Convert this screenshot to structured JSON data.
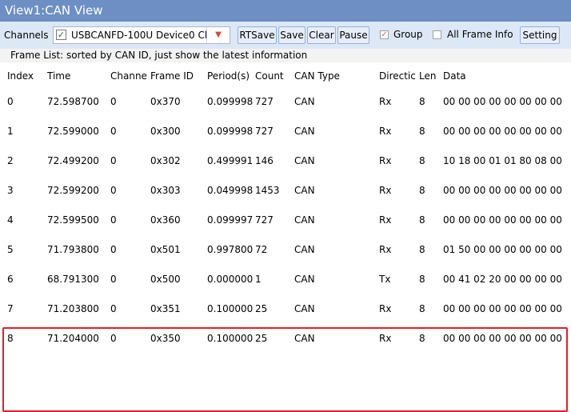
{
  "window": {
    "title": "View1:CAN View"
  },
  "toolbar": {
    "channels_label": "Channels",
    "channel_value": "USBCANFD-100U Device0 Ch",
    "buttons": [
      "RTSave",
      "Save",
      "Clear",
      "Pause",
      "Setting"
    ],
    "group_label": "Group",
    "group_checked": true,
    "all_frame_label": "All Frame Info",
    "all_frame_checked": false
  },
  "frame_list": {
    "caption": "Frame List: sorted by CAN ID, just show the latest information",
    "columns": [
      "Index",
      "Time",
      "Channe",
      "Frame ID",
      "Period(s)",
      "Count",
      "CAN Type",
      "Directic",
      "Len",
      "Data"
    ],
    "rows": [
      [
        "0",
        "72.598700",
        "0",
        "0x370",
        "0.099998",
        "727",
        "CAN",
        "Rx",
        "8",
        "00 00 00 00 00 00 00 00"
      ],
      [
        "1",
        "72.599000",
        "0",
        "0x300",
        "0.099998",
        "727",
        "CAN",
        "Rx",
        "8",
        "00 00 00 00 00 00 00 00"
      ],
      [
        "2",
        "72.499200",
        "0",
        "0x302",
        "0.499991",
        "146",
        "CAN",
        "Rx",
        "8",
        "10 18 00 01 01 80 08 00"
      ],
      [
        "3",
        "72.599200",
        "0",
        "0x303",
        "0.049998",
        "1453",
        "CAN",
        "Rx",
        "8",
        "00 00 00 00 00 00 00 00"
      ],
      [
        "4",
        "72.599500",
        "0",
        "0x360",
        "0.099997",
        "727",
        "CAN",
        "Rx",
        "8",
        "00 00 00 00 00 00 00 00"
      ],
      [
        "5",
        "71.793800",
        "0",
        "0x501",
        "0.997800",
        "72",
        "CAN",
        "Rx",
        "8",
        "01 50 00 00 00 00 00 00"
      ],
      [
        "6",
        "68.791300",
        "0",
        "0x500",
        "0.000000",
        "1",
        "CAN",
        "Tx",
        "8",
        "00 41 02 20 00 00 00 00"
      ],
      [
        "7",
        "71.203800",
        "0",
        "0x351",
        "0.100000",
        "25",
        "CAN",
        "Rx",
        "8",
        "00 00 00 00 00 00 00 00"
      ],
      [
        "8",
        "71.204000",
        "0",
        "0x350",
        "0.100000",
        "25",
        "CAN",
        "Rx",
        "8",
        "00 00 00 00 00 00 00 00"
      ]
    ]
  },
  "colors": {
    "title_bar": "#6d8fc4",
    "toolbar_bg": "#dde8f6",
    "highlight_border": "#e0202a"
  }
}
